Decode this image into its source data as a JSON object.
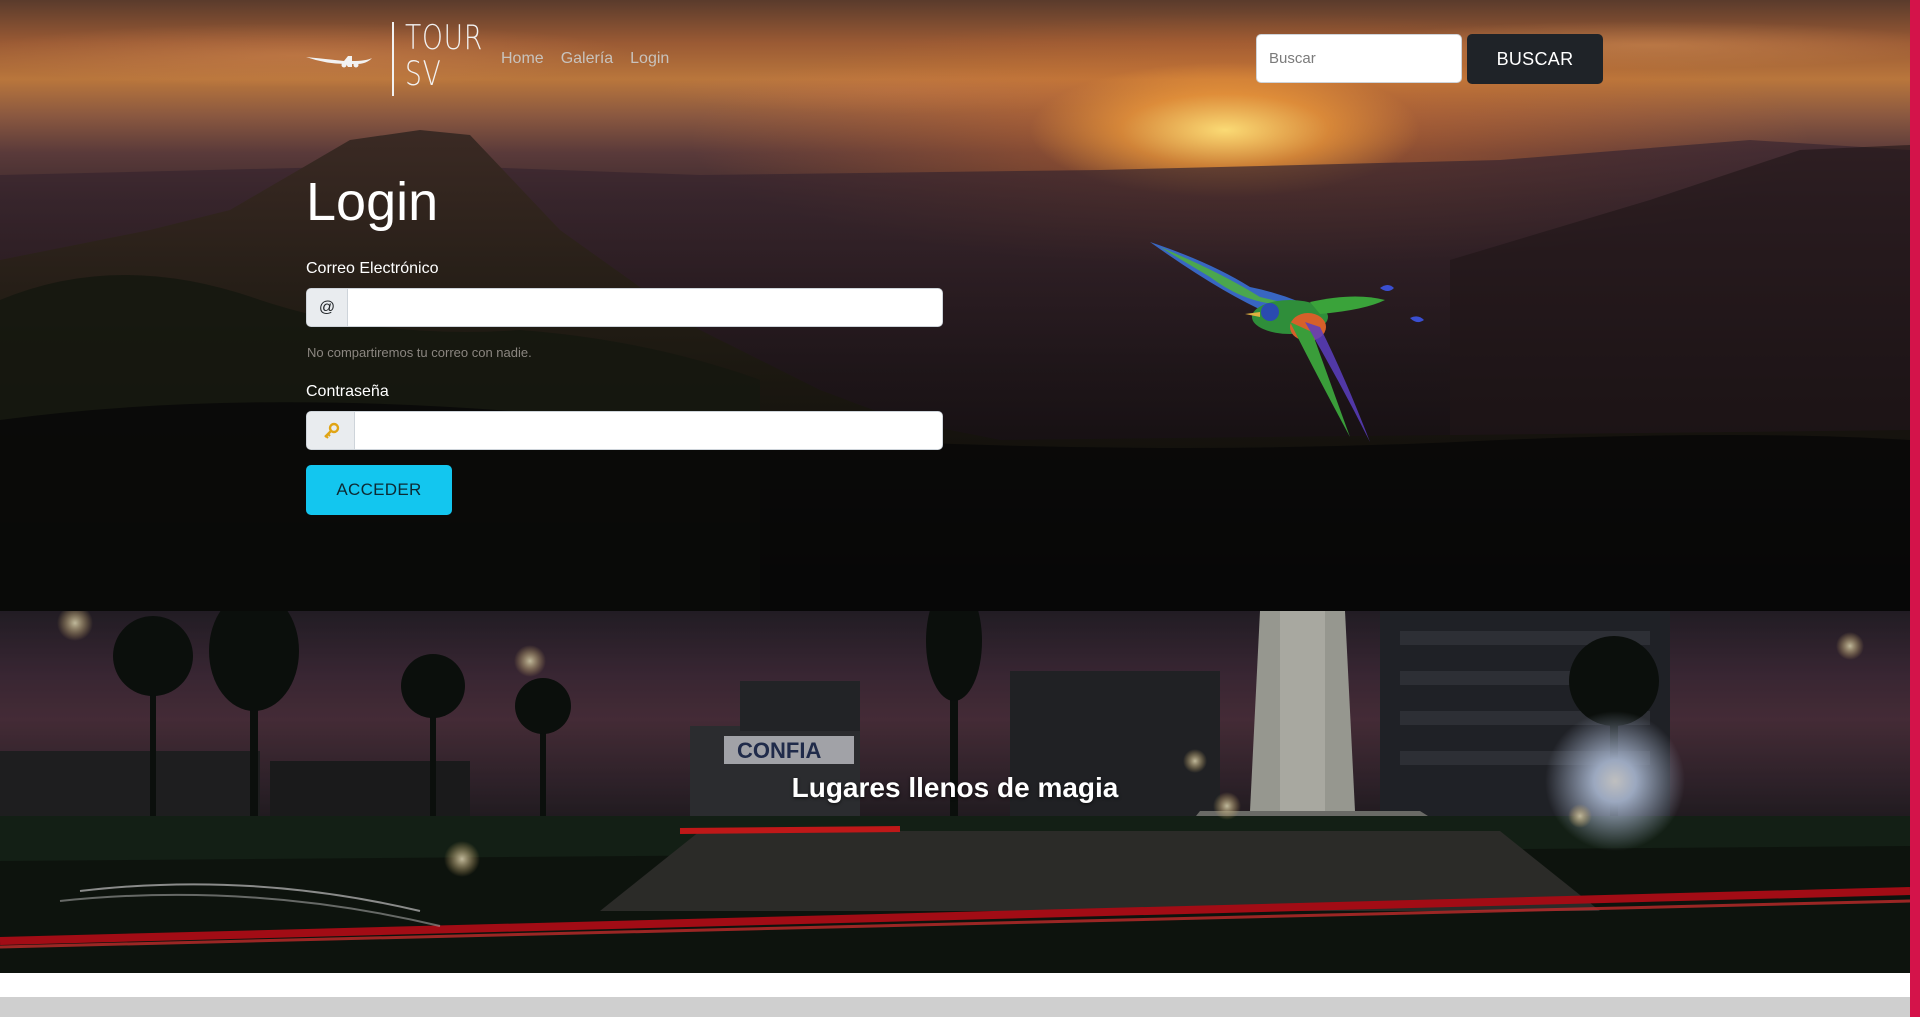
{
  "brand": {
    "logo_line1": "TOUR",
    "logo_line2": "SV"
  },
  "nav": {
    "links": [
      {
        "label": "Home"
      },
      {
        "label": "Galería"
      },
      {
        "label": "Login"
      }
    ]
  },
  "search": {
    "placeholder": "Buscar",
    "button_label": "BUSCAR"
  },
  "login": {
    "title": "Login",
    "email_label": "Correo Electrónico",
    "email_addon": "@",
    "email_help": "No compartiremos tu correo con nadie.",
    "password_label": "Contraseña",
    "submit_label": "ACCEDER"
  },
  "feature": {
    "caption": "Lugares llenos de magia",
    "sign_text": "CONFIA"
  },
  "colors": {
    "accent_button": "#13c6ef",
    "search_button": "#1f2328",
    "edge_stripe": "#d4134a"
  },
  "icons": {
    "password_addon": "key-icon",
    "logo_plane": "airplane-icon"
  }
}
